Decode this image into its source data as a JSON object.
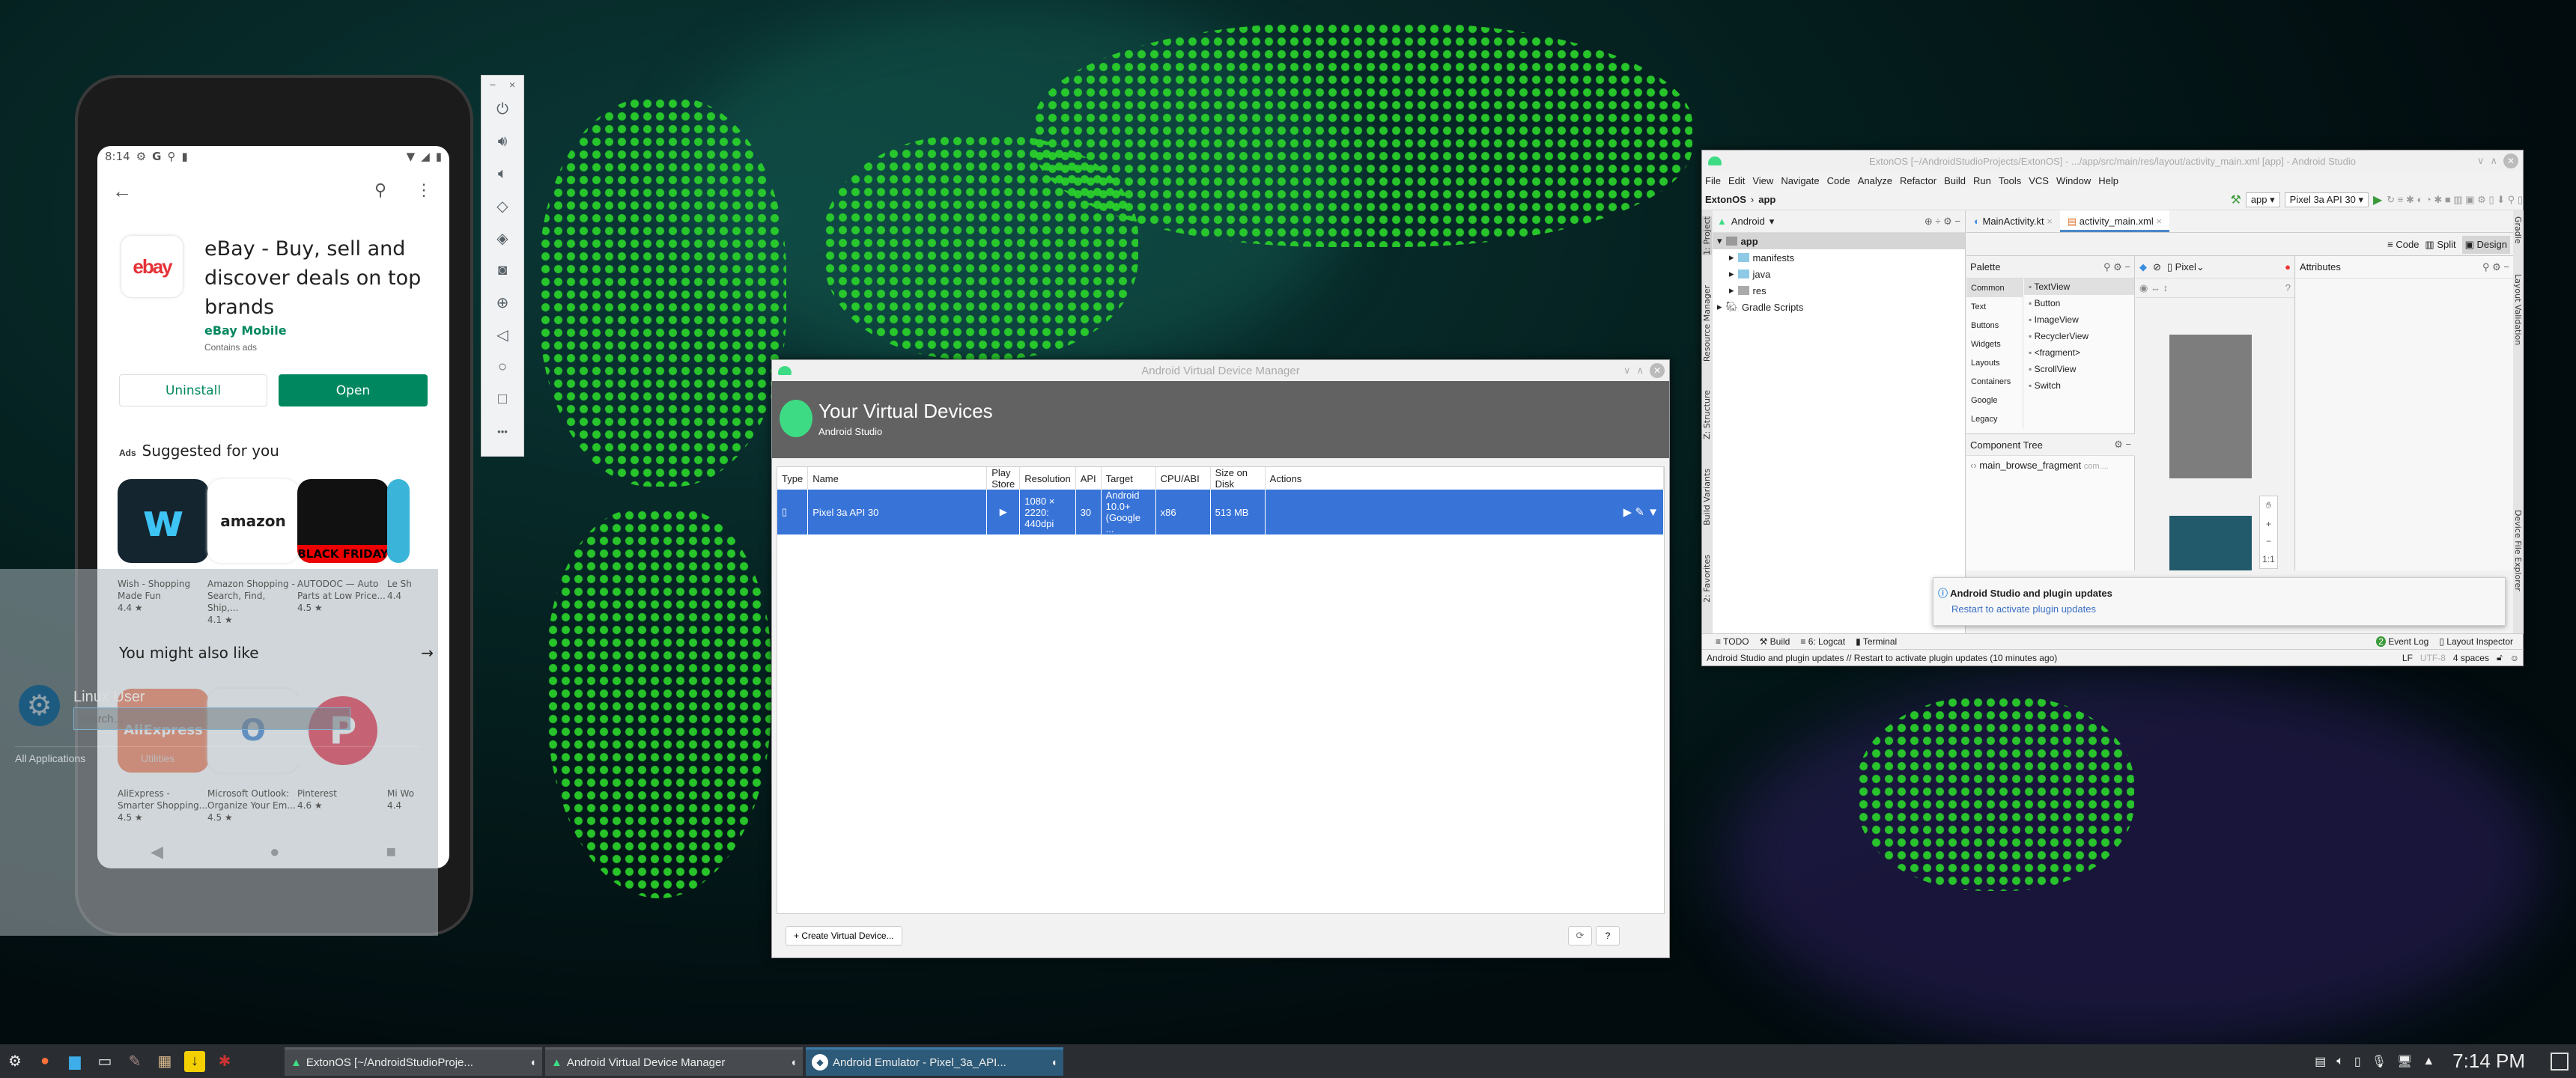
{
  "colors": {
    "accent_blue": "#3874d8",
    "play_green": "#01875f",
    "android_green": "#3ddc84",
    "taskbar": "#2a2e32",
    "bg_dots": "#2bd62b"
  },
  "phone": {
    "status_time": "8:14",
    "status_icons": [
      "gear-icon",
      "google-icon",
      "location-icon",
      "sd-card-icon",
      "wifi-icon",
      "signal-icon",
      "battery-icon"
    ],
    "app_title": "eBay - Buy, sell and discover deals on top brands",
    "developer": "eBay Mobile",
    "contains_ads": "Contains ads",
    "icon_text": "ebay",
    "uninstall": "Uninstall",
    "open": "Open",
    "ads_label": "Ads",
    "suggested_title": "Suggested for you",
    "suggested": [
      {
        "name": "Wish - Shopping Made Fun",
        "rating": "4.4 ★",
        "icon": "w"
      },
      {
        "name": "Amazon Shopping - Search, Find, Ship,...",
        "rating": "4.1 ★",
        "icon": "amazon"
      },
      {
        "name": "AUTODOC — Auto Parts at Low Price...",
        "rating": "4.5 ★",
        "icon": "BLACK FRIDAY"
      },
      {
        "name": "Le Sh",
        "rating": "4.4"
      }
    ],
    "also_like_title": "You might also like",
    "also_like": [
      {
        "name": "AliExpress - Smarter Shopping...",
        "rating": "4.5 ★",
        "icon": "AliExpress"
      },
      {
        "name": "Microsoft Outlook: Organize Your Em...",
        "rating": "4.5 ★",
        "icon": "O"
      },
      {
        "name": "Pinterest",
        "rating": "4.6 ★",
        "icon": "P"
      },
      {
        "name": "Mi Wo",
        "rating": "4.4"
      }
    ]
  },
  "emulator_toolbar": {
    "minimize": "−",
    "close": "×",
    "more": "•••",
    "tools": [
      "power-icon",
      "volume-up-icon",
      "volume-down-icon",
      "rotate-left-icon",
      "rotate-right-icon",
      "camera-icon",
      "zoom-icon",
      "back-icon",
      "home-icon",
      "overview-icon"
    ]
  },
  "launcher": {
    "user": "Linux User",
    "search_placeholder": "Search...",
    "all_apps": "All Applications",
    "category": "Utilities"
  },
  "avd": {
    "window_title": "Android Virtual Device Manager",
    "heading": "Your Virtual Devices",
    "subheading": "Android Studio",
    "columns": [
      "Type",
      "Name",
      "Play Store",
      "Resolution",
      "API",
      "Target",
      "CPU/ABI",
      "Size on Disk",
      "Actions"
    ],
    "rows": [
      {
        "name": "Pixel 3a API 30",
        "resolution": "1080 × 2220: 440dpi",
        "api": "30",
        "target": "Android 10.0+ (Google ...",
        "cpu": "x86",
        "size": "513 MB"
      }
    ],
    "create_button": "+ Create Virtual Device...",
    "help_button": "?"
  },
  "studio": {
    "window_title": "ExtonOS [~/AndroidStudioProjects/ExtonOS] - .../app/src/main/res/layout/activity_main.xml [app] - Android Studio",
    "menu": [
      "File",
      "Edit",
      "View",
      "Navigate",
      "Code",
      "Analyze",
      "Refactor",
      "Build",
      "Run",
      "Tools",
      "VCS",
      "Window",
      "Help"
    ],
    "breadcrumb": [
      "ExtonOS",
      "app"
    ],
    "run_config": "app",
    "device": "Pixel 3a API 30",
    "project_view": "Android",
    "tree": [
      {
        "label": "app",
        "level": 0
      },
      {
        "label": "manifests",
        "level": 1
      },
      {
        "label": "java",
        "level": 1
      },
      {
        "label": "res",
        "level": 1
      },
      {
        "label": "Gradle Scripts",
        "level": 0
      }
    ],
    "tabs": [
      "MainActivity.kt",
      "activity_main.xml"
    ],
    "view_modes": [
      "Code",
      "Split",
      "Design"
    ],
    "palette_title": "Palette",
    "palette_categories": [
      "Common",
      "Text",
      "Buttons",
      "Widgets",
      "Layouts",
      "Containers",
      "Google",
      "Legacy"
    ],
    "palette_items": [
      "TextView",
      "Button",
      "ImageView",
      "RecyclerView",
      "<fragment>",
      "ScrollView",
      "Switch"
    ],
    "device_selector": "Pixel",
    "attributes_title": "Attributes",
    "component_tree_title": "Component Tree",
    "component": "main_browse_fragment",
    "component_suffix": "com....",
    "zoom_ratio": "1:1",
    "left_tools": [
      "1: Project",
      "Resource Manager",
      "Z: Structure",
      "Build Variants",
      "2: Favorites"
    ],
    "right_tools": [
      "Gradle",
      "Layout Validation",
      "Device File Explorer"
    ],
    "bottom_tools": [
      "TODO",
      "Build",
      "6: Logcat",
      "Terminal"
    ],
    "event_log_count": "2",
    "event_log": "Event Log",
    "layout_inspector": "Layout Inspector",
    "notification_title": "Android Studio and plugin updates",
    "notification_link": "Restart to activate plugin updates",
    "status_message": "Android Studio and plugin updates // Restart to activate plugin updates (10 minutes ago)",
    "status_right": [
      "LF",
      "UTF-8",
      "4 spaces"
    ]
  },
  "taskbar": {
    "launchers": [
      "kde-menu-icon",
      "firefox-icon",
      "file-manager-icon",
      "system-monitor-icon",
      "gimp-icon",
      "archive-icon",
      "download-icon",
      "settings-tool-icon"
    ],
    "tasks": [
      {
        "label": "ExtonOS [~/AndroidStudioProje...",
        "active": false
      },
      {
        "label": "Android Virtual Device Manager",
        "active": false
      },
      {
        "label": "Android Emulator - Pixel_3a_API...",
        "active": true
      }
    ],
    "clock": "7:14 PM"
  }
}
